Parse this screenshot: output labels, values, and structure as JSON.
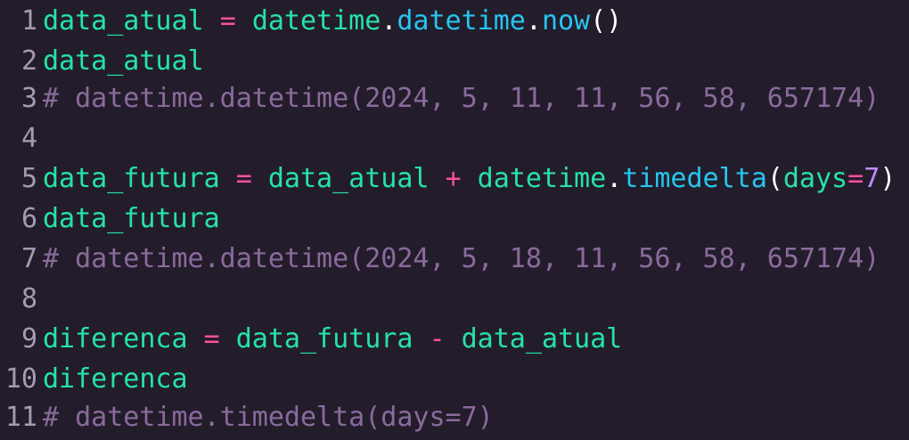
{
  "colors": {
    "background": "#231d2b",
    "line_number": "#a49bb0",
    "identifier": "#26e3a5",
    "operator": "#ff4fa0",
    "function": "#27c4f0",
    "punctuation": "#ffffff",
    "comment": "#8a6a9c"
  },
  "lines": [
    {
      "number": "1",
      "tokens": [
        {
          "t": "data_atual",
          "k": "ident"
        },
        {
          "t": " ",
          "k": "ident"
        },
        {
          "t": "=",
          "k": "op"
        },
        {
          "t": " ",
          "k": "ident"
        },
        {
          "t": "datetime",
          "k": "ident"
        },
        {
          "t": ".",
          "k": "punct"
        },
        {
          "t": "datetime",
          "k": "func"
        },
        {
          "t": ".",
          "k": "punct"
        },
        {
          "t": "now",
          "k": "func"
        },
        {
          "t": "()",
          "k": "punct"
        }
      ]
    },
    {
      "number": "2",
      "tokens": [
        {
          "t": "data_atual",
          "k": "ident"
        }
      ]
    },
    {
      "number": "3",
      "tokens": [
        {
          "t": "# datetime.datetime(2024, 5, 11, 11, 56, 58, 657174)",
          "k": "comment"
        }
      ]
    },
    {
      "number": "4",
      "tokens": []
    },
    {
      "number": "5",
      "tokens": [
        {
          "t": "data_futura",
          "k": "ident"
        },
        {
          "t": " ",
          "k": "ident"
        },
        {
          "t": "=",
          "k": "op"
        },
        {
          "t": " data_atual ",
          "k": "ident"
        },
        {
          "t": "+",
          "k": "op"
        },
        {
          "t": " datetime",
          "k": "ident"
        },
        {
          "t": ".",
          "k": "punct"
        },
        {
          "t": "timedelta",
          "k": "func"
        },
        {
          "t": "(",
          "k": "punct"
        },
        {
          "t": "days",
          "k": "ident"
        },
        {
          "t": "=",
          "k": "op"
        },
        {
          "t": "7",
          "k": "num"
        },
        {
          "t": ")",
          "k": "punct"
        }
      ]
    },
    {
      "number": "6",
      "tokens": [
        {
          "t": "data_futura",
          "k": "ident"
        }
      ]
    },
    {
      "number": "7",
      "tokens": [
        {
          "t": "# datetime.datetime(2024, 5, 18, 11, 56, 58, 657174)",
          "k": "comment"
        }
      ]
    },
    {
      "number": "8",
      "tokens": []
    },
    {
      "number": "9",
      "tokens": [
        {
          "t": "diferenca",
          "k": "ident"
        },
        {
          "t": " ",
          "k": "ident"
        },
        {
          "t": "=",
          "k": "op"
        },
        {
          "t": " data_futura ",
          "k": "ident"
        },
        {
          "t": "-",
          "k": "op"
        },
        {
          "t": " data_atual",
          "k": "ident"
        }
      ]
    },
    {
      "number": "10",
      "tokens": [
        {
          "t": "diferenca",
          "k": "ident"
        }
      ]
    },
    {
      "number": "11",
      "tokens": [
        {
          "t": "# datetime.timedelta(days=7)",
          "k": "comment"
        }
      ]
    }
  ]
}
